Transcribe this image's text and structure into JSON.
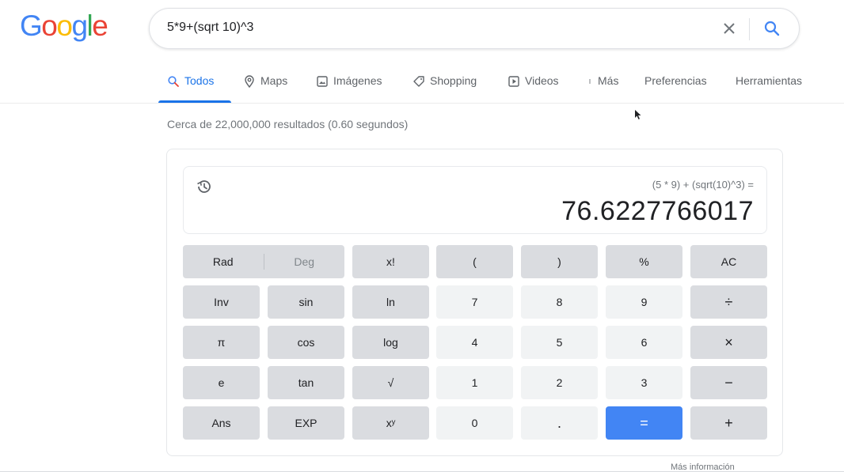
{
  "logo": {
    "letters": [
      "G",
      "o",
      "o",
      "g",
      "l",
      "e"
    ],
    "colors": [
      "#4285f4",
      "#ea4335",
      "#fbbc05",
      "#4285f4",
      "#34a853",
      "#ea4335"
    ]
  },
  "search": {
    "query": "5*9+(sqrt 10)^3",
    "clear_icon": "close-icon",
    "search_icon": "search-icon"
  },
  "tabs": [
    {
      "label": "Todos",
      "icon": "search-icon",
      "active": true
    },
    {
      "label": "Maps",
      "icon": "map-pin-icon",
      "active": false
    },
    {
      "label": "Imágenes",
      "icon": "image-icon",
      "active": false
    },
    {
      "label": "Shopping",
      "icon": "tag-icon",
      "active": false
    },
    {
      "label": "Videos",
      "icon": "play-icon",
      "active": false
    },
    {
      "label": "Más",
      "icon": "more-vert-icon",
      "active": false
    },
    {
      "label": "Preferencias",
      "icon": "",
      "active": false
    },
    {
      "label": "Herramientas",
      "icon": "",
      "active": false
    }
  ],
  "stats": "Cerca de 22,000,000 resultados (0.60 segundos)",
  "calculator": {
    "expression": "(5 * 9) + (sqrt(10)^3) =",
    "result": "76.6227766017",
    "mode": {
      "rad": "Rad",
      "deg": "Deg"
    },
    "buttons": {
      "fact": "x!",
      "lparen": "(",
      "rparen": ")",
      "percent": "%",
      "ac": "AC",
      "inv": "Inv",
      "sin": "sin",
      "ln": "ln",
      "n7": "7",
      "n8": "8",
      "n9": "9",
      "divide": "÷",
      "pi": "π",
      "cos": "cos",
      "log": "log",
      "n4": "4",
      "n5": "5",
      "n6": "6",
      "multiply": "×",
      "e": "e",
      "tan": "tan",
      "sqrt": "√",
      "n1": "1",
      "n2": "2",
      "n3": "3",
      "minus": "−",
      "ans": "Ans",
      "exp": "EXP",
      "pow": "xʸ",
      "n0": "0",
      "dot": ".",
      "equals": "=",
      "plus": "+"
    },
    "more_info": "Más información"
  },
  "accent_color": "#1a73e8",
  "equals_color": "#4285f4"
}
